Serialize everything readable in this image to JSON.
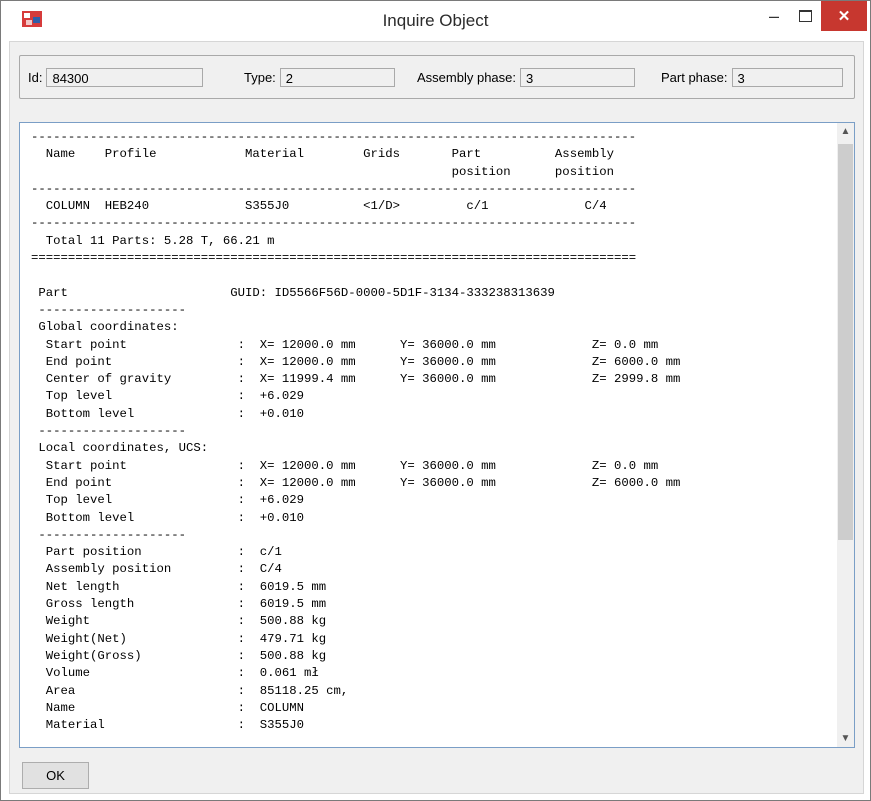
{
  "window": {
    "title": "Inquire Object"
  },
  "fields": {
    "id_label": "Id:",
    "id_value": "84300",
    "type_label": "Type:",
    "type_value": "2",
    "assembly_phase_label": "Assembly phase:",
    "assembly_phase_value": "3",
    "part_phase_label": "Part phase:",
    "part_phase_value": "3"
  },
  "report_lines": [
    "----------------------------------------------------------------------------------",
    "  Name    Profile            Material        Grids       Part          Assembly",
    "                                                         position      position",
    "----------------------------------------------------------------------------------",
    "  COLUMN  HEB240             S355J0          <1/D>         c/1             C/4",
    "----------------------------------------------------------------------------------",
    "  Total 11 Parts: 5.28 T, 66.21 m",
    "==================================================================================",
    "",
    " Part                      GUID: ID5566F56D-0000-5D1F-3134-333238313639",
    " --------------------",
    " Global coordinates:",
    "  Start point               :  X= 12000.0 mm      Y= 36000.0 mm             Z= 0.0 mm",
    "  End point                 :  X= 12000.0 mm      Y= 36000.0 mm             Z= 6000.0 mm",
    "  Center of gravity         :  X= 11999.4 mm      Y= 36000.0 mm             Z= 2999.8 mm",
    "  Top level                 :  +6.029",
    "  Bottom level              :  +0.010",
    " --------------------",
    " Local coordinates, UCS:",
    "  Start point               :  X= 12000.0 mm      Y= 36000.0 mm             Z= 0.0 mm",
    "  End point                 :  X= 12000.0 mm      Y= 36000.0 mm             Z= 6000.0 mm",
    "  Top level                 :  +6.029",
    "  Bottom level              :  +0.010",
    " --------------------",
    "  Part position             :  c/1",
    "  Assembly position         :  C/4",
    "  Net length                :  6019.5 mm",
    "  Gross length              :  6019.5 mm",
    "  Weight                    :  500.88 kg",
    "  Weight(Net)               :  479.71 kg",
    "  Weight(Gross)             :  500.88 kg",
    "  Volume                    :  0.061 mł",
    "  Area                      :  85118.25 cm,",
    "  Name                      :  COLUMN",
    "  Material                  :  S355J0"
  ],
  "buttons": {
    "ok": "OK",
    "minimize": "–",
    "close": "✕"
  },
  "icons": {
    "app": "tekla-app-icon",
    "scroll_up": "▲",
    "scroll_down": "▼"
  }
}
